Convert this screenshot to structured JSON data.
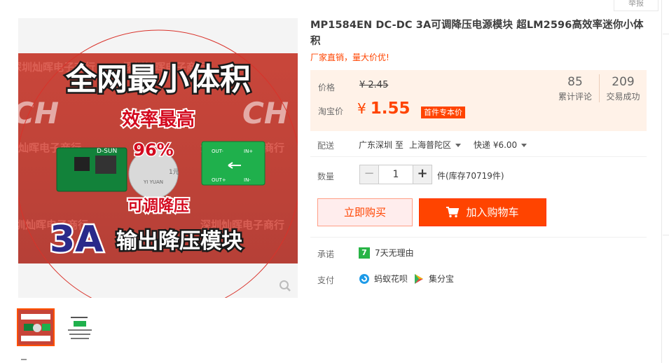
{
  "report_label": "举报",
  "product": {
    "title": "MP1584EN DC-DC 3A可调降压电源模块 超LM2596高效率迷你小体积",
    "subtitle": "厂家直销，量大价优!"
  },
  "image_text": {
    "headline": "全网最小体积",
    "efficiency_label": "效率最高",
    "efficiency_value": "96%",
    "adjustable": "可调降压",
    "amp": "3A",
    "module": "输出降压模块",
    "chip_label": "D-SUN",
    "pin_out_minus": "OUT-",
    "pin_in_plus": "IN+",
    "pin_out_plus": "OUT+",
    "pin_in_minus": "IN-",
    "coin_text": "YI YUAN",
    "coin_value": "1元",
    "watermark": "深圳灿晖电子商行",
    "watermark_logo": "CH"
  },
  "pricing": {
    "price_label": "价格",
    "old_price": "¥ 2.45",
    "taobao_label": "淘宝价",
    "currency": "¥",
    "price": "1.55",
    "badge": "首件专本价",
    "reviews_count": "85",
    "reviews_label": "累计评论",
    "deals_count": "209",
    "deals_label": "交易成功"
  },
  "delivery": {
    "label": "配送",
    "from": "广东深圳 至",
    "to": "上海普陀区",
    "fee": "快递 ¥6.00"
  },
  "quantity": {
    "label": "数量",
    "minus": "−",
    "value": "1",
    "plus": "+",
    "stock": "件(库存70719件)"
  },
  "actions": {
    "buy_now": "立即购买",
    "add_to_cart": "加入购物车"
  },
  "promise": {
    "label": "承诺",
    "icon_text": "7",
    "text": "7天无理由"
  },
  "payment": {
    "label": "支付",
    "method1": "蚂蚁花呗",
    "method2": "集分宝"
  },
  "thumbnails": [
    "main-product-photo",
    "schematic-photo"
  ],
  "colors": {
    "accent": "#ff4400",
    "price_bg": "#fff2e8",
    "buy_now_bg": "#ffeded",
    "promise_green": "#28b446"
  }
}
